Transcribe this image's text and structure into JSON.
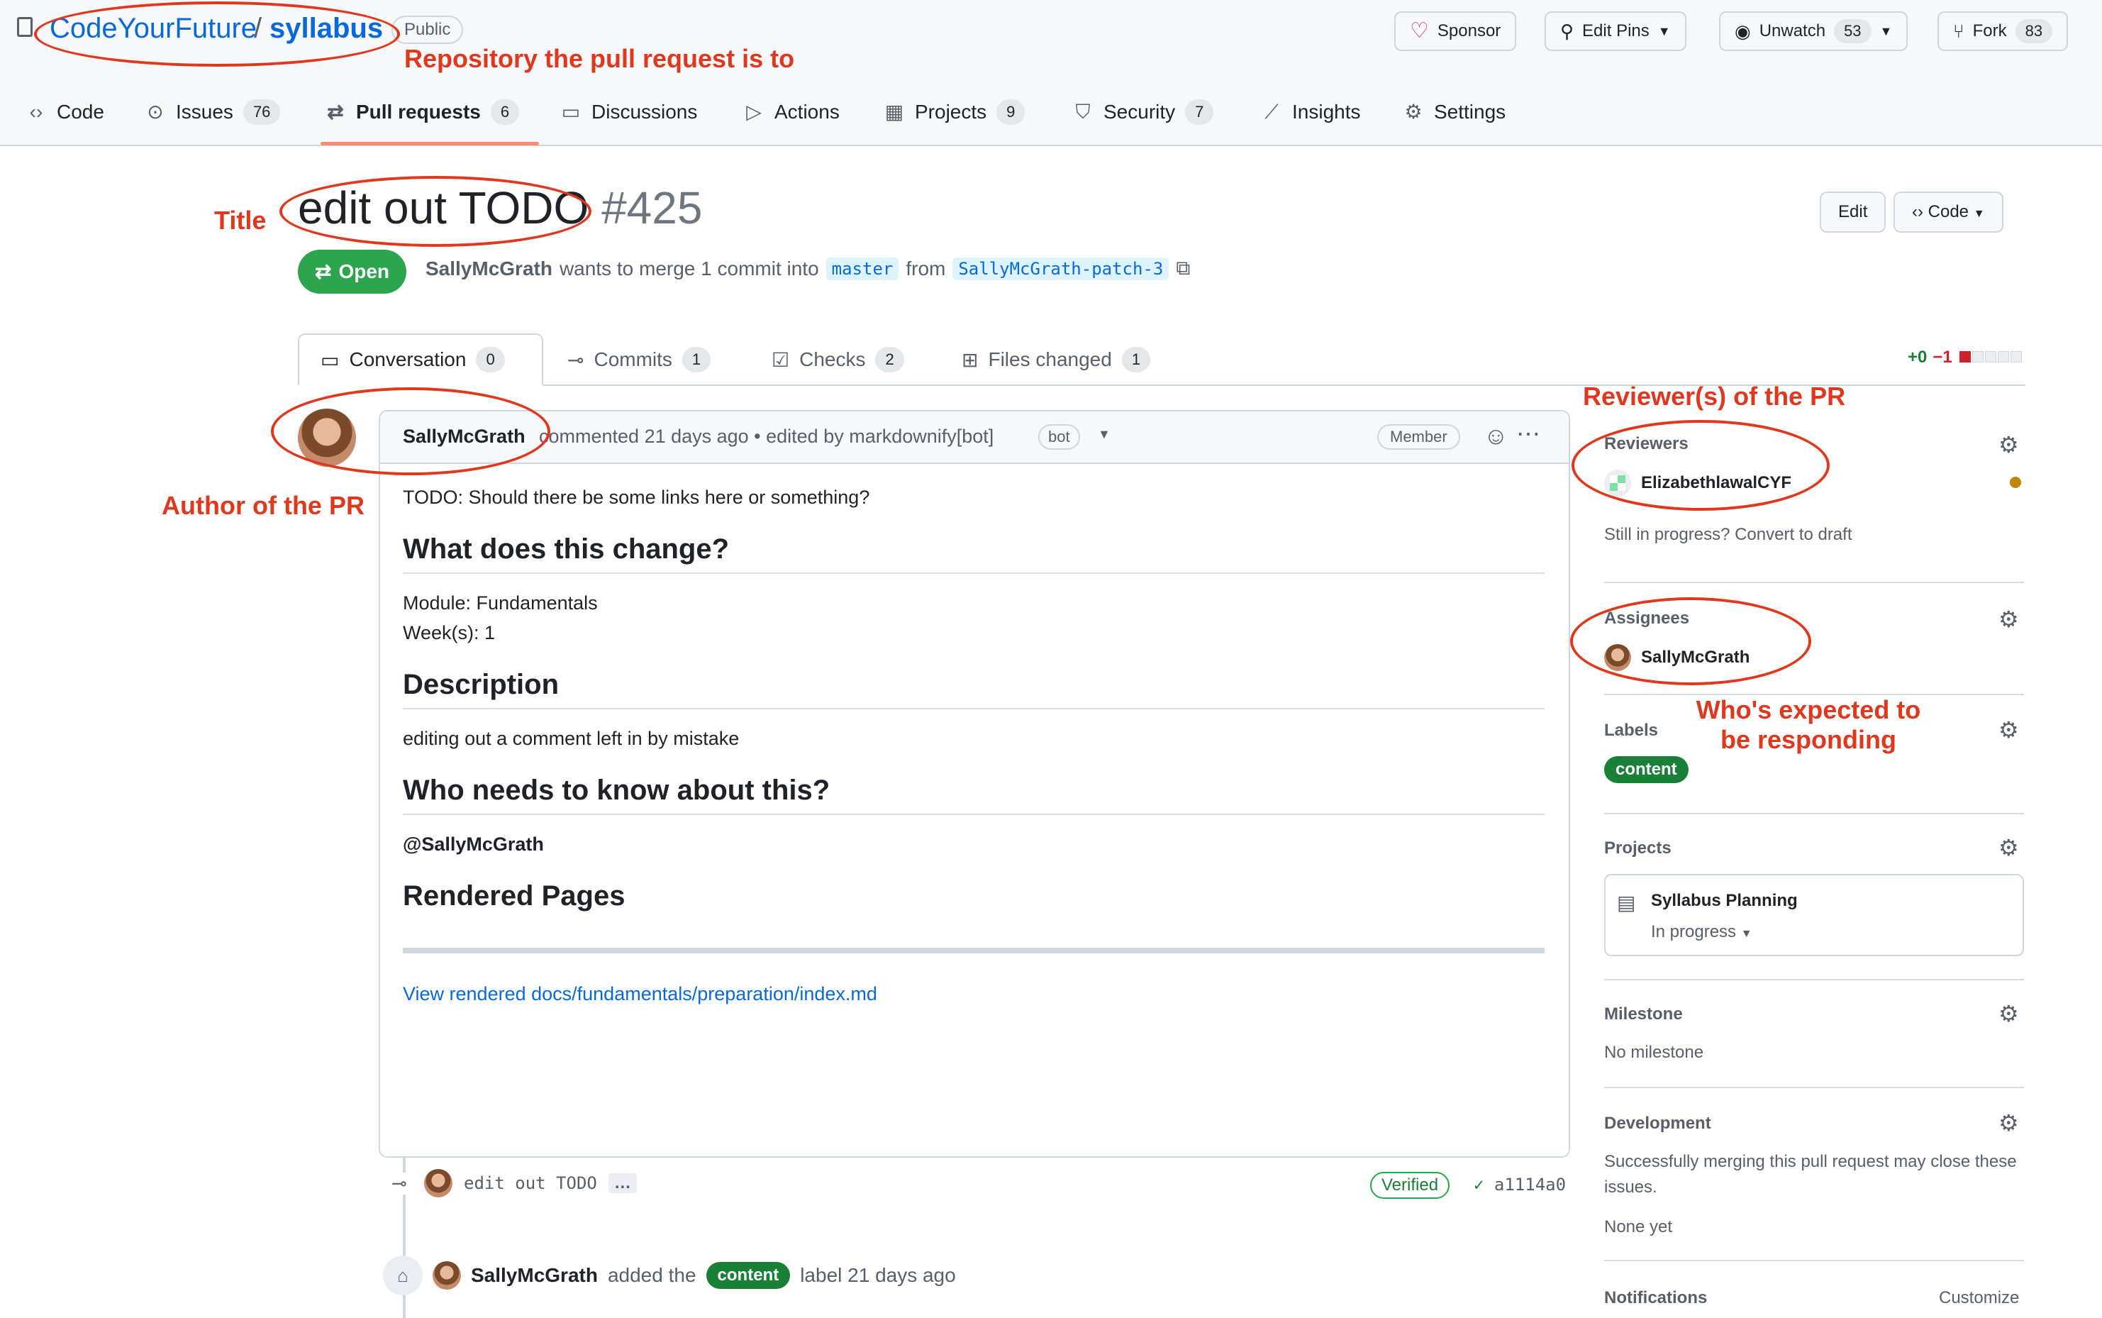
{
  "repo": {
    "owner": "CodeYourFuture",
    "slash": "/",
    "name": "syllabus",
    "visibility": "Public"
  },
  "header_buttons": {
    "sponsor": "Sponsor",
    "edit_pins": "Edit Pins",
    "unwatch": "Unwatch",
    "unwatch_count": "53",
    "fork": "Fork",
    "fork_count": "83"
  },
  "nav": [
    {
      "label": "Code",
      "icon": "code-icon"
    },
    {
      "label": "Issues",
      "count": "76",
      "icon": "issue-icon"
    },
    {
      "label": "Pull requests",
      "count": "6",
      "icon": "pull-request-icon"
    },
    {
      "label": "Discussions",
      "icon": "discussion-icon"
    },
    {
      "label": "Actions",
      "icon": "play-icon"
    },
    {
      "label": "Projects",
      "count": "9",
      "icon": "table-icon"
    },
    {
      "label": "Security",
      "count": "7",
      "icon": "shield-icon"
    },
    {
      "label": "Insights",
      "icon": "graph-icon"
    },
    {
      "label": "Settings",
      "icon": "gear-icon"
    }
  ],
  "pr": {
    "title": "edit out TODO",
    "number": "#425",
    "state": "Open",
    "author": "SallyMcGrath",
    "merge_text": "wants to merge 1 commit into",
    "base_branch": "master",
    "from_text": "from",
    "head_branch": "SallyMcGrath-patch-3",
    "edit_label": "Edit",
    "code_label": "Code"
  },
  "tabs": [
    {
      "label": "Conversation",
      "count": "0"
    },
    {
      "label": "Commits",
      "count": "1"
    },
    {
      "label": "Checks",
      "count": "2"
    },
    {
      "label": "Files changed",
      "count": "1"
    }
  ],
  "diffstat": {
    "added": "+0",
    "removed": "−1"
  },
  "comment": {
    "author": "SallyMcGrath",
    "meta": "commented 21 days ago • edited by markdownify[bot]",
    "bot_badge": "bot",
    "member_badge": "Member",
    "todo": "TODO: Should there be some links here or something?",
    "h_change": "What does this change?",
    "module": "Module: Fundamentals",
    "weeks": "Week(s): 1",
    "h_description": "Description",
    "description": "editing out a comment left in by mistake",
    "h_who": "Who needs to know about this?",
    "mention": "@SallyMcGrath",
    "h_rendered": "Rendered Pages",
    "rendered_link": "View rendered docs/fundamentals/preparation/index.md"
  },
  "timeline": {
    "commit_msg": "edit out TODO",
    "commit_more": "…",
    "verified": "Verified",
    "sha": "a1114a0",
    "label_actor": "SallyMcGrath",
    "label_text_before": "added the",
    "label_name": "content",
    "label_text_after": "label 21 days ago"
  },
  "sidebar": {
    "reviewers_title": "Reviewers",
    "reviewer": "ElizabethlawalCYF",
    "draft_text": "Still in progress? Convert to draft",
    "assignees_title": "Assignees",
    "assignee": "SallyMcGrath",
    "labels_title": "Labels",
    "label": "content",
    "projects_title": "Projects",
    "project_name": "Syllabus Planning",
    "project_status": "In progress",
    "milestone_title": "Milestone",
    "milestone_value": "No milestone",
    "development_title": "Development",
    "development_text": "Successfully merging this pull request may close these issues.",
    "development_value": "None yet",
    "notifications_title": "Notifications",
    "customize": "Customize"
  },
  "annotations": {
    "repo": "Repository the pull request is to",
    "title": "Title",
    "author": "Author of the PR",
    "reviewers": "Reviewer(s) of the PR",
    "responding_line1": "Who's expected to",
    "responding_line2": "be responding"
  },
  "colors": {
    "accent": "#0969da",
    "open_green": "#2da44e",
    "annotation_red": "#e0381e",
    "label_green": "#1a7f37"
  }
}
